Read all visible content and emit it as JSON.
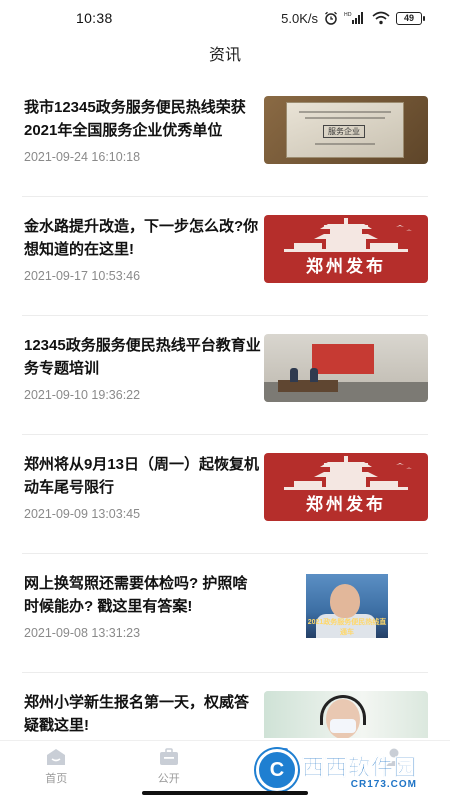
{
  "status_bar": {
    "time": "10:38",
    "network_speed": "5.0K/s",
    "battery": "49",
    "icons": [
      "alarm-icon",
      "hd-signal-icon",
      "wifi-icon",
      "battery-icon"
    ]
  },
  "header": {
    "title": "资讯"
  },
  "news": [
    {
      "title": "我市12345政务服务便民热线荣获2021年全国服务企业优秀单位",
      "date": "2021-09-24 16:10:18",
      "thumb": "plaque",
      "thumb_text": "服务企业"
    },
    {
      "title": "金水路提升改造，下一步怎么改?你想知道的在这里!",
      "date": "2021-09-17 10:53:46",
      "thumb": "zhengzhou",
      "thumb_text": "郑州发布"
    },
    {
      "title": "12345政务服务便民热线平台教育业务专题培训",
      "date": "2021-09-10 19:36:22",
      "thumb": "hall",
      "thumb_text": ""
    },
    {
      "title": "郑州将从9月13日（周一）起恢复机动车尾号限行",
      "date": "2021-09-09 13:03:45",
      "thumb": "zhengzhou",
      "thumb_text": "郑州发布"
    },
    {
      "title": "网上换驾照还需要体检吗? 护照啥时候能办? 戳这里有答案!",
      "date": "2021-09-08 13:31:23",
      "thumb": "face",
      "thumb_text": "2021政务服务便民热线直通车"
    },
    {
      "title": "郑州小学新生报名第一天，权威答疑戳这里!",
      "date": "",
      "thumb": "doctor",
      "thumb_text": ""
    }
  ],
  "tabbar": {
    "tabs": [
      {
        "label": "首页",
        "icon": "home-icon"
      },
      {
        "label": "公开",
        "icon": "briefcase-icon"
      },
      {
        "label": "资",
        "icon": "info-icon"
      },
      {
        "label": "",
        "icon": "profile-icon"
      }
    ]
  },
  "watermark": {
    "main": "西西软件园",
    "sub": "CR173.COM"
  },
  "colors": {
    "accent": "#4a90e2",
    "zz_red": "#b52e2b",
    "tab_gray": "#9a9a9a"
  }
}
